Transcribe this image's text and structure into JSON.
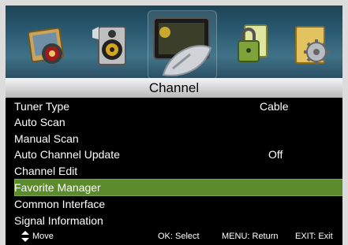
{
  "menu_title": "Channel",
  "icons": [
    {
      "name": "picture-icon"
    },
    {
      "name": "sound-icon"
    },
    {
      "name": "channel-satellite-icon",
      "selected": true
    },
    {
      "name": "lock-icon"
    },
    {
      "name": "setup-gear-icon"
    }
  ],
  "items": [
    {
      "label": "Tuner Type",
      "value": "Cable"
    },
    {
      "label": "Auto Scan"
    },
    {
      "label": "Manual Scan"
    },
    {
      "label": "Auto Channel Update",
      "value": "Off"
    },
    {
      "label": "Channel Edit"
    },
    {
      "label": "Favorite Manager",
      "highlighted": true
    },
    {
      "label": "Common Interface"
    },
    {
      "label": "Signal Information"
    }
  ],
  "footer": {
    "move": "Move",
    "ok": "OK: Select",
    "menu": "MENU: Return",
    "exit": "EXIT: Exit"
  },
  "colors": {
    "highlight": "#5b8b2a",
    "background": "#000000",
    "icon_strip": "#2a5a71"
  }
}
